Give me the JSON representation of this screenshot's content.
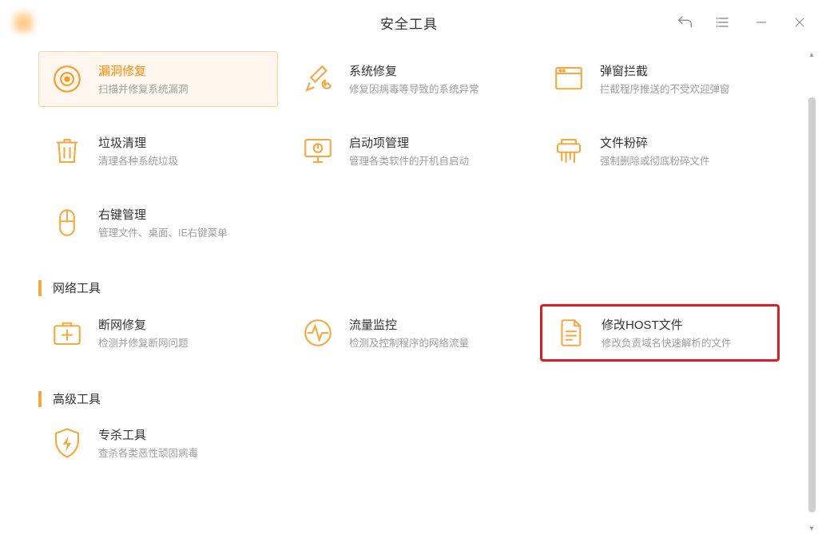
{
  "titlebar": {
    "logo_text": "    ",
    "title": "安全工具"
  },
  "sections": {
    "network": "网络工具",
    "advanced": "高级工具"
  },
  "tiles": {
    "vuln": {
      "title": "漏洞修复",
      "desc": "扫描并修复系统漏洞"
    },
    "sysrepair": {
      "title": "系统修复",
      "desc": "修复因病毒等导致的系统异常"
    },
    "popup": {
      "title": "弹窗拦截",
      "desc": "拦截程序推送的不受欢迎弹窗"
    },
    "trash": {
      "title": "垃圾清理",
      "desc": "清理各种系统垃圾"
    },
    "startup": {
      "title": "启动项管理",
      "desc": "管理各类软件的开机自启动"
    },
    "shred": {
      "title": "文件粉碎",
      "desc": "强制删除或彻底粉碎文件"
    },
    "context": {
      "title": "右键管理",
      "desc": "管理文件、桌面、IE右键菜单"
    },
    "netfix": {
      "title": "断网修复",
      "desc": "检测并修复断网问题"
    },
    "traffic": {
      "title": "流量监控",
      "desc": "检测及控制程序的网络流量"
    },
    "host": {
      "title": "修改HOST文件",
      "desc": "修改负责域名快速解析的文件"
    },
    "kill": {
      "title": "专杀工具",
      "desc": "查杀各类恶性顽固病毒"
    }
  }
}
